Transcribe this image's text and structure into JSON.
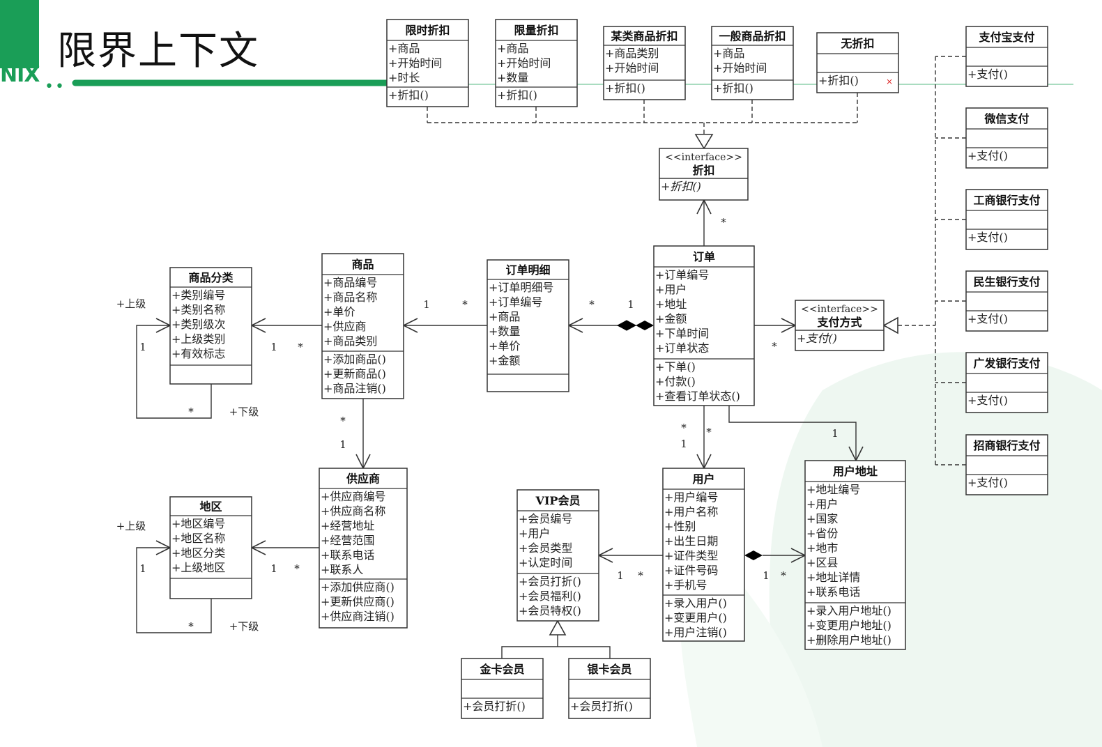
{
  "page": {
    "title": "限界上下文",
    "logo": "NIX"
  },
  "colors": {
    "brand": "#1a9e57",
    "line": "#333333"
  },
  "classes": {
    "timeLimited": {
      "name": "限时折扣",
      "attrs": [
        "+商品",
        "+开始时间",
        "+时长"
      ],
      "ops": [
        "+折扣()"
      ]
    },
    "qtyLimited": {
      "name": "限量折扣",
      "attrs": [
        "+商品",
        "+开始时间",
        "+数量"
      ],
      "ops": [
        "+折扣()"
      ]
    },
    "categoryDiscount": {
      "name": "某类商品折扣",
      "attrs": [
        "+商品类别",
        "+开始时间"
      ],
      "ops": [
        "+折扣()"
      ]
    },
    "generalDiscount": {
      "name": "一般商品折扣",
      "attrs": [
        "+商品",
        "+开始时间"
      ],
      "ops": [
        "+折扣()"
      ]
    },
    "noDiscount": {
      "name": "无折扣",
      "attrs": [],
      "ops": [
        "+折扣()"
      ]
    },
    "discountInterface": {
      "stereotype": "<<interface>>",
      "name": "折扣",
      "attrs": [],
      "ops": [
        "+折扣()"
      ]
    },
    "alipay": {
      "name": "支付宝支付",
      "attrs": [],
      "ops": [
        "+支付()"
      ]
    },
    "wechat": {
      "name": "微信支付",
      "attrs": [],
      "ops": [
        "+支付()"
      ]
    },
    "icbc": {
      "name": "工商银行支付",
      "attrs": [],
      "ops": [
        "+支付()"
      ]
    },
    "cmbc": {
      "name": "民生银行支付",
      "attrs": [],
      "ops": [
        "+支付()"
      ]
    },
    "cgb": {
      "name": "广发银行支付",
      "attrs": [],
      "ops": [
        "+支付()"
      ]
    },
    "cmb": {
      "name": "招商银行支付",
      "attrs": [],
      "ops": [
        "+支付()"
      ]
    },
    "paymentInterface": {
      "stereotype": "<<interface>>",
      "name": "支付方式",
      "attrs": [],
      "ops": [
        "+支付()"
      ]
    },
    "order": {
      "name": "订单",
      "attrs": [
        "+订单编号",
        "+用户",
        "+地址",
        "+金额",
        "+下单时间",
        "+订单状态"
      ],
      "ops": [
        "+下单()",
        "+付款()",
        "+查看订单状态()"
      ]
    },
    "orderDetail": {
      "name": "订单明细",
      "attrs": [
        "+订单明细号",
        "+订单编号",
        "+商品",
        "+数量",
        "+单价",
        "+金额"
      ],
      "ops": []
    },
    "product": {
      "name": "商品",
      "attrs": [
        "+商品编号",
        "+商品名称",
        "+单价",
        "+供应商",
        "+商品类别"
      ],
      "ops": [
        "+添加商品()",
        "+更新商品()",
        "+商品注销()"
      ]
    },
    "category": {
      "name": "商品分类",
      "attrs": [
        "+类别编号",
        "+类别名称",
        "+类别级次",
        "+上级类别",
        "+有效标志"
      ],
      "ops": []
    },
    "supplier": {
      "name": "供应商",
      "attrs": [
        "+供应商编号",
        "+供应商名称",
        "+经营地址",
        "+经营范围",
        "+联系电话",
        "+联系人"
      ],
      "ops": [
        "+添加供应商()",
        "+更新供应商()",
        "+供应商注销()"
      ]
    },
    "region": {
      "name": "地区",
      "attrs": [
        "+地区编号",
        "+地区名称",
        "+地区分类",
        "+上级地区"
      ],
      "ops": []
    },
    "vip": {
      "name": "VIP会员",
      "attrs": [
        "+会员编号",
        "+用户",
        "+会员类型",
        "+认定时间"
      ],
      "ops": [
        "+会员打折()",
        "+会员福利()",
        "+会员特权()"
      ]
    },
    "user": {
      "name": "用户",
      "attrs": [
        "+用户编号",
        "+用户名称",
        "+性别",
        "+出生日期",
        "+证件类型",
        "+证件号码",
        "+手机号"
      ],
      "ops": [
        "+录入用户()",
        "+变更用户()",
        "+用户注销()"
      ]
    },
    "address": {
      "name": "用户地址",
      "attrs": [
        "+地址编号",
        "+用户",
        "+国家",
        "+省份",
        "+地市",
        "+区县",
        "+地址详情",
        "+联系电话"
      ],
      "ops": [
        "+录入用户地址()",
        "+变更用户地址()",
        "+删除用户地址()"
      ]
    },
    "goldCard": {
      "name": "金卡会员",
      "attrs": [],
      "ops": [
        "+会员打折()"
      ]
    },
    "silverCard": {
      "name": "银卡会员",
      "attrs": [],
      "ops": [
        "+会员打折()"
      ]
    }
  },
  "labels": {
    "one": "1",
    "many": "*",
    "parent": "+上级",
    "child": "+下级",
    "x": "×"
  }
}
